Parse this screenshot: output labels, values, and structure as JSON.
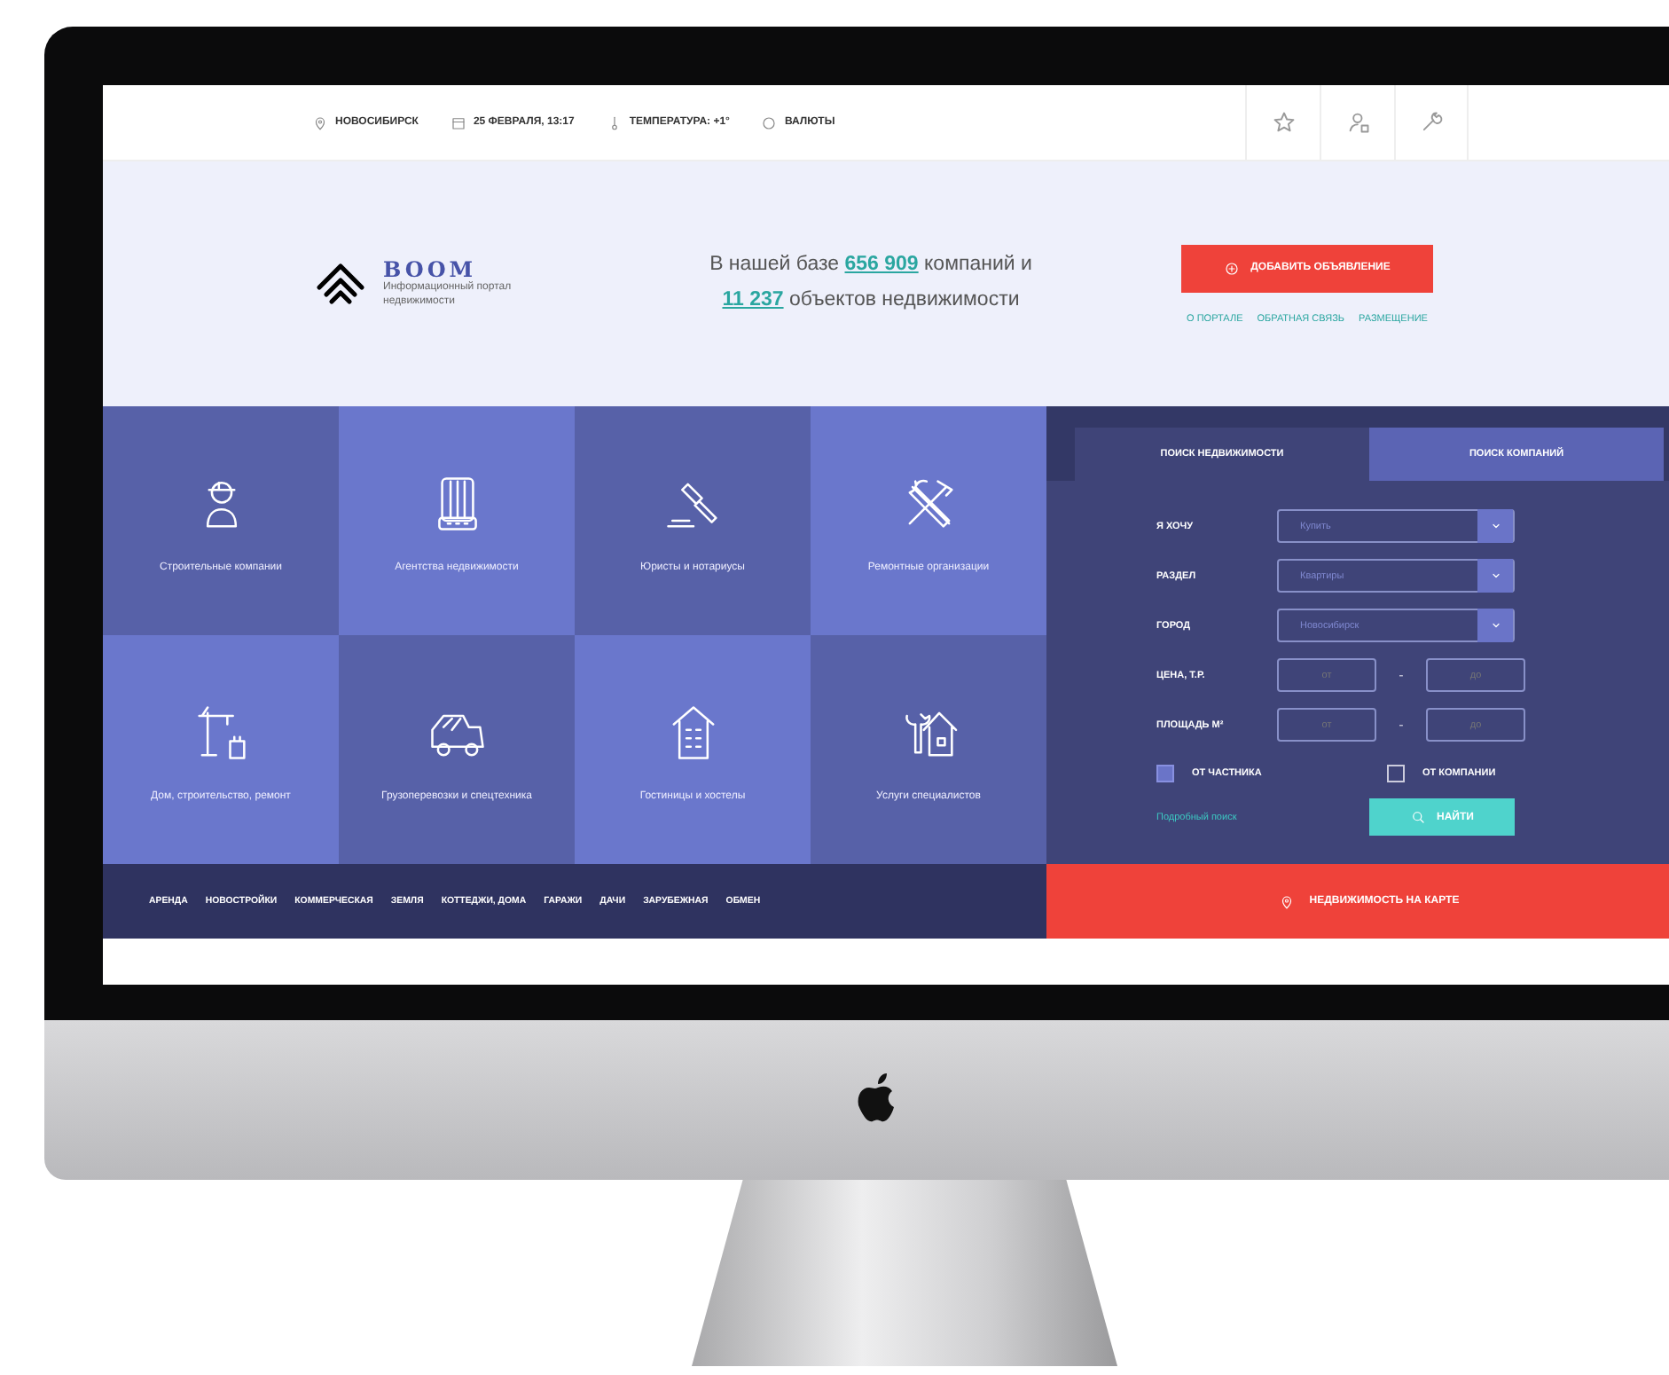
{
  "top_bar": {
    "items": [
      {
        "kind": "pin",
        "text": "НОВОСИБИРСК"
      },
      {
        "kind": "calendar",
        "text": "25 ФЕВРАЛЯ, 13:17"
      },
      {
        "kind": "thermometer",
        "text": "ТЕМПЕРАТУРА: +1°"
      },
      {
        "kind": "coin",
        "text": "ВАЛЮТЫ"
      }
    ]
  },
  "hero": {
    "logo": {
      "name": "BOOM",
      "tagline": "Информационный портал недвижимости"
    },
    "headline": [
      [
        {
          "text": "В нашей базе ",
          "highlight": false
        },
        {
          "text": "656 909",
          "highlight": true
        },
        {
          "text": " компаний и",
          "highlight": false
        }
      ],
      [
        {
          "text": "11 237",
          "highlight": true
        },
        {
          "text": " объектов недвижимости",
          "highlight": false
        }
      ]
    ],
    "add_button": "ДОБАВИТЬ ОБЪЯВЛЕНИЕ",
    "links": [
      "О ПОРТАЛЕ",
      "ОБРАТНАЯ СВЯЗЬ",
      "РАЗМЕЩЕНИЕ"
    ]
  },
  "categories": [
    {
      "label": "Строительные компании",
      "color": "#5761a8"
    },
    {
      "label": "Агентства недвижимости",
      "color": "#6a77cc"
    },
    {
      "label": "Юристы и нотариусы",
      "color": "#5761a8"
    },
    {
      "label": "Ремонтные организации",
      "color": "#6a77cc"
    },
    {
      "label": "Дом, строительство, ремонт",
      "color": "#6a77cc"
    },
    {
      "label": "Грузоперевозки и спецтехника",
      "color": "#5761a8"
    },
    {
      "label": "Гостиницы и хостелы",
      "color": "#6a77cc"
    },
    {
      "label": "Услуги специалистов",
      "color": "#5761a8"
    }
  ],
  "search": {
    "tabs": [
      {
        "label": "ПОИСК НЕДВИЖИМОСТИ",
        "selected": true
      },
      {
        "label": "ПОИСК КОМПАНИЙ",
        "selected": false
      }
    ],
    "fields": [
      {
        "kind": "select",
        "label": "Я ХОЧУ",
        "value": "Купить"
      },
      {
        "kind": "select",
        "label": "РАЗДЕЛ",
        "value": "Квартиры"
      },
      {
        "kind": "select",
        "label": "ГОРОД",
        "value": "Новосибирск"
      },
      {
        "kind": "range",
        "label": "ЦЕНА, Т.Р.",
        "inputs": [
          {
            "placeholder": "от"
          },
          {
            "placeholder": "до"
          }
        ],
        "separator": "-"
      },
      {
        "kind": "range",
        "label": "ПЛОЩАДЬ М²",
        "inputs": [
          {
            "placeholder": "от"
          },
          {
            "placeholder": "до"
          }
        ],
        "separator": "-"
      }
    ],
    "checkboxes": [
      {
        "label": "ОТ ЧАСТНИКА",
        "checked": true
      },
      {
        "label": "ОТ КОМПАНИИ",
        "checked": false
      }
    ],
    "advanced_link": "Подробный поиск",
    "submit": "НАЙТИ"
  },
  "nav": [
    "АРЕНДА",
    "НОВОСТРОЙКИ",
    "КОММЕРЧЕСКАЯ",
    "ЗЕМЛЯ",
    "КОТТЕДЖИ, ДОМА",
    "ГАРАЖИ",
    "ДАЧИ",
    "ЗАРУБЕЖНАЯ",
    "ОБМЕН"
  ],
  "map_button": "НЕДВИЖИМОСТЬ НА КАРТЕ"
}
